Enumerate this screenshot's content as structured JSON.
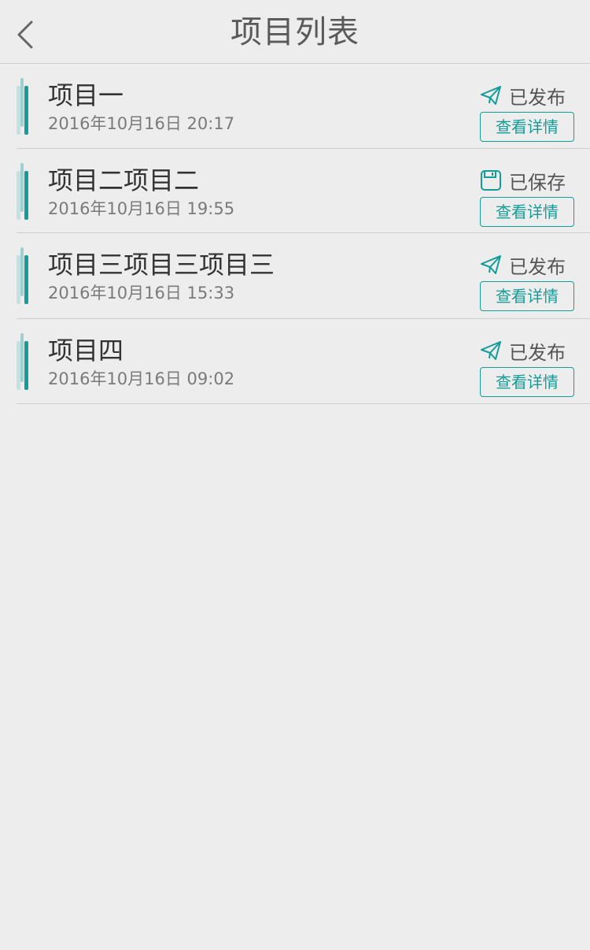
{
  "header": {
    "title": "项目列表",
    "back_icon": "chevron-left-icon"
  },
  "colors": {
    "accent": "#149c98",
    "background": "#ededed",
    "divider": "#cfcfcf",
    "title_text": "#333333",
    "time_text": "#7a7a7a"
  },
  "projects": [
    {
      "title": "项目一",
      "time": "2016年10月16日 20:17",
      "status": "已发布",
      "status_icon": "paper-plane-icon",
      "button": "查看详情"
    },
    {
      "title": "项目二项目二",
      "time": "2016年10月16日 19:55",
      "status": "已保存",
      "status_icon": "save-icon",
      "button": "查看详情"
    },
    {
      "title": "项目三项目三项目三",
      "time": "2016年10月16日 15:33",
      "status": "已发布",
      "status_icon": "paper-plane-icon",
      "button": "查看详情"
    },
    {
      "title": "项目四",
      "time": "2016年10月16日 09:02",
      "status": "已发布",
      "status_icon": "paper-plane-icon",
      "button": "查看详情"
    }
  ]
}
